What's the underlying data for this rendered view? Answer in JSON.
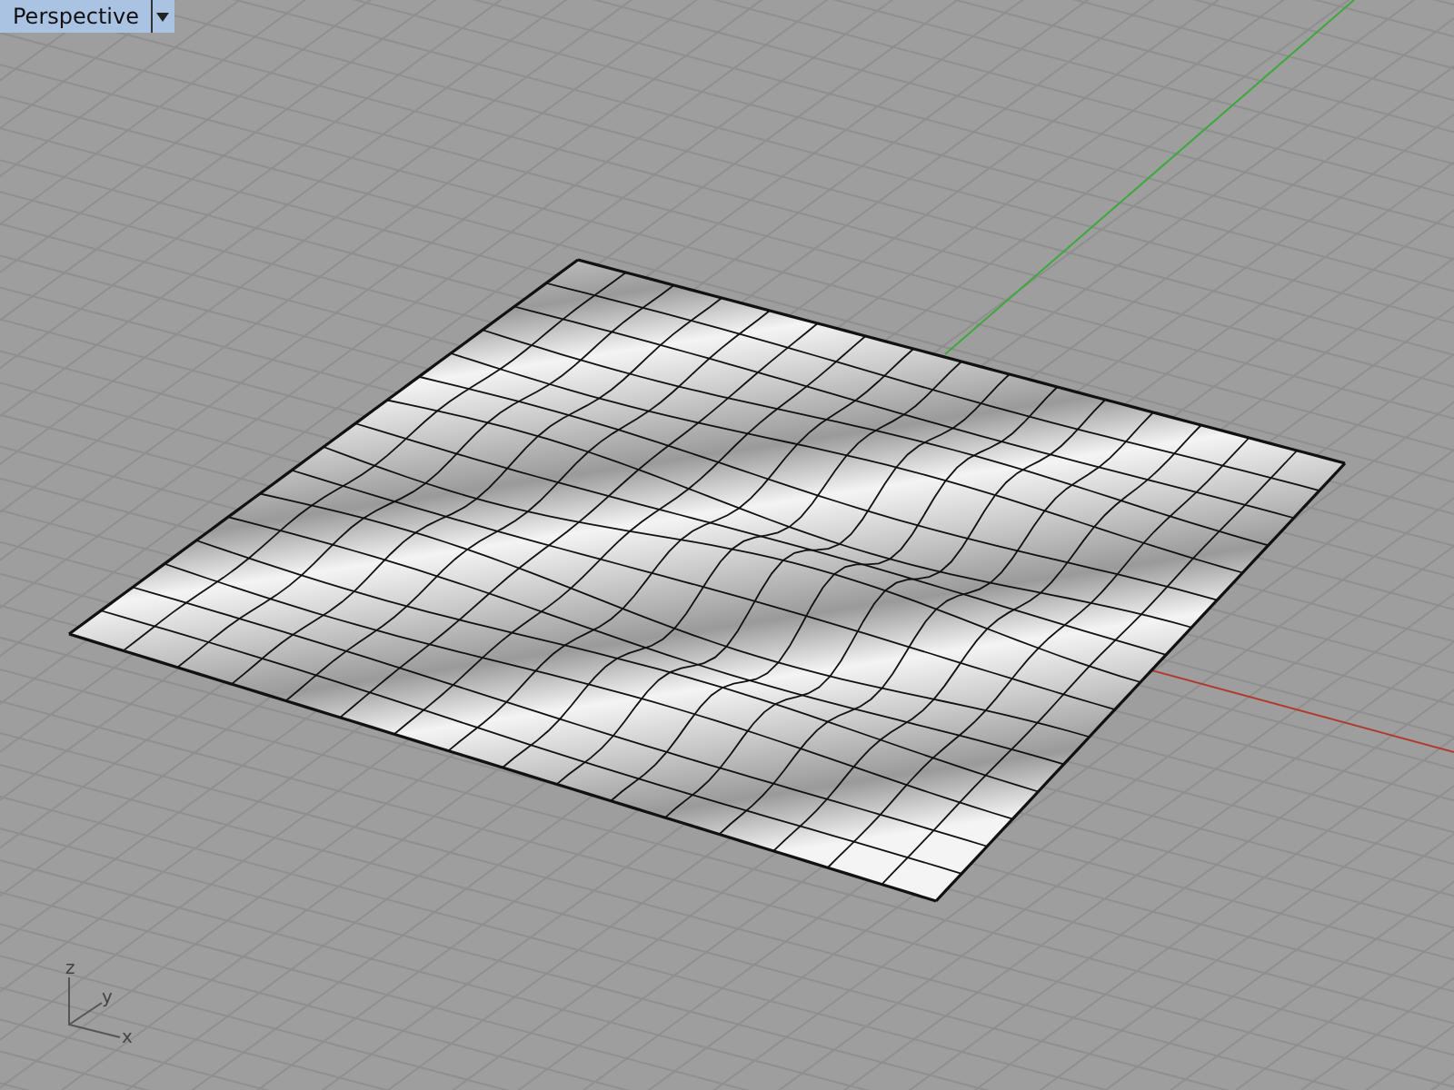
{
  "viewport": {
    "title": "Perspective"
  },
  "axis_widget": {
    "labels": [
      {
        "kind": "z",
        "text": "z"
      },
      {
        "kind": "y",
        "text": "y"
      },
      {
        "kind": "x",
        "text": "x"
      }
    ]
  }
}
